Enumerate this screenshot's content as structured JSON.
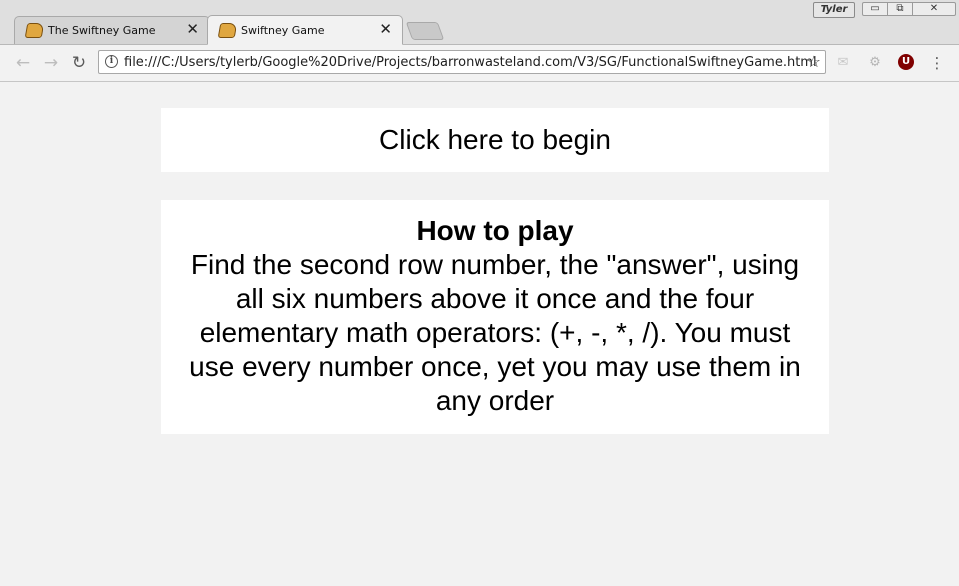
{
  "browser": {
    "tabs": [
      {
        "title": "The Swiftney Game",
        "close": "✕",
        "active": false
      },
      {
        "title": "Swiftney Game",
        "close": "✕",
        "active": true
      }
    ],
    "profile_name": "Tyler",
    "window_controls": {
      "minimize": "▭",
      "maximize": "⧉",
      "close": "✕"
    },
    "url": "file:///C:/Users/tylerb/Google%20Drive/Projects/barronwasteland.com/V3/SG/FunctionalSwiftneyGame.html",
    "icons": {
      "back": "←",
      "forward": "→",
      "reload": "↻",
      "info": "i",
      "star": "☆",
      "mail": "✉",
      "extension": "⚙",
      "ublock": "U",
      "menu": "⋮"
    }
  },
  "page": {
    "begin_label": "Click here to begin",
    "howto_title": "How to play",
    "howto_text": "Find the second row number, the \"answer\", using all six numbers above it once and the four elementary math operators: (+, -, *, /). You must use every number once, yet you may use them in any order"
  }
}
